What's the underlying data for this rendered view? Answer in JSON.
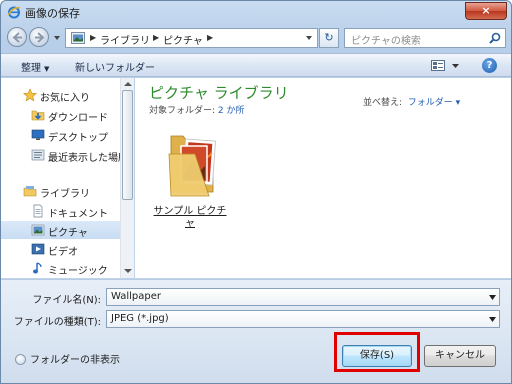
{
  "window": {
    "title": "画像の保存",
    "close_label": "×"
  },
  "address": {
    "crumbs": [
      "ライブラリ",
      "ピクチャ"
    ],
    "search_placeholder": "ピクチャの検索"
  },
  "toolbar": {
    "organize": "整理",
    "new_folder": "新しいフォルダー"
  },
  "navpane": {
    "items": [
      {
        "label": "お気に入り",
        "icon": "star-icon",
        "indent": 0
      },
      {
        "label": "ダウンロード",
        "icon": "download-folder-icon",
        "indent": 1
      },
      {
        "label": "デスクトップ",
        "icon": "desktop-icon",
        "indent": 1
      },
      {
        "label": "最近表示した場所",
        "icon": "recent-places-icon",
        "indent": 1
      },
      {
        "label": "ライブラリ",
        "icon": "library-icon",
        "indent": 0
      },
      {
        "label": "ドキュメント",
        "icon": "documents-icon",
        "indent": 1
      },
      {
        "label": "ピクチャ",
        "icon": "pictures-icon",
        "indent": 1,
        "selected": true
      },
      {
        "label": "ビデオ",
        "icon": "videos-icon",
        "indent": 1
      },
      {
        "label": "ミュージック",
        "icon": "music-icon",
        "indent": 1
      }
    ]
  },
  "content": {
    "library_title": "ピクチャ ライブラリ",
    "subtitle_prefix": "対象フォルダー:",
    "subtitle_link": "2 か所",
    "arrange_label": "並べ替え:",
    "arrange_value": "フォルダー",
    "items": [
      {
        "label": "サンプル ピクチャ",
        "icon": "sample-pictures-folder-icon"
      }
    ]
  },
  "form": {
    "filename_label": "ファイル名(N):",
    "filename_value": "Wallpaper",
    "filetype_label": "ファイルの種類(T):",
    "filetype_value": "JPEG (*.jpg)"
  },
  "footer": {
    "hide_folders": "フォルダーの非表示",
    "save_button": "保存(S)",
    "cancel_button": "キャンセル"
  },
  "colors": {
    "highlight": "#e00000",
    "library_title": "#2e8a2e",
    "link": "#2360b4"
  }
}
